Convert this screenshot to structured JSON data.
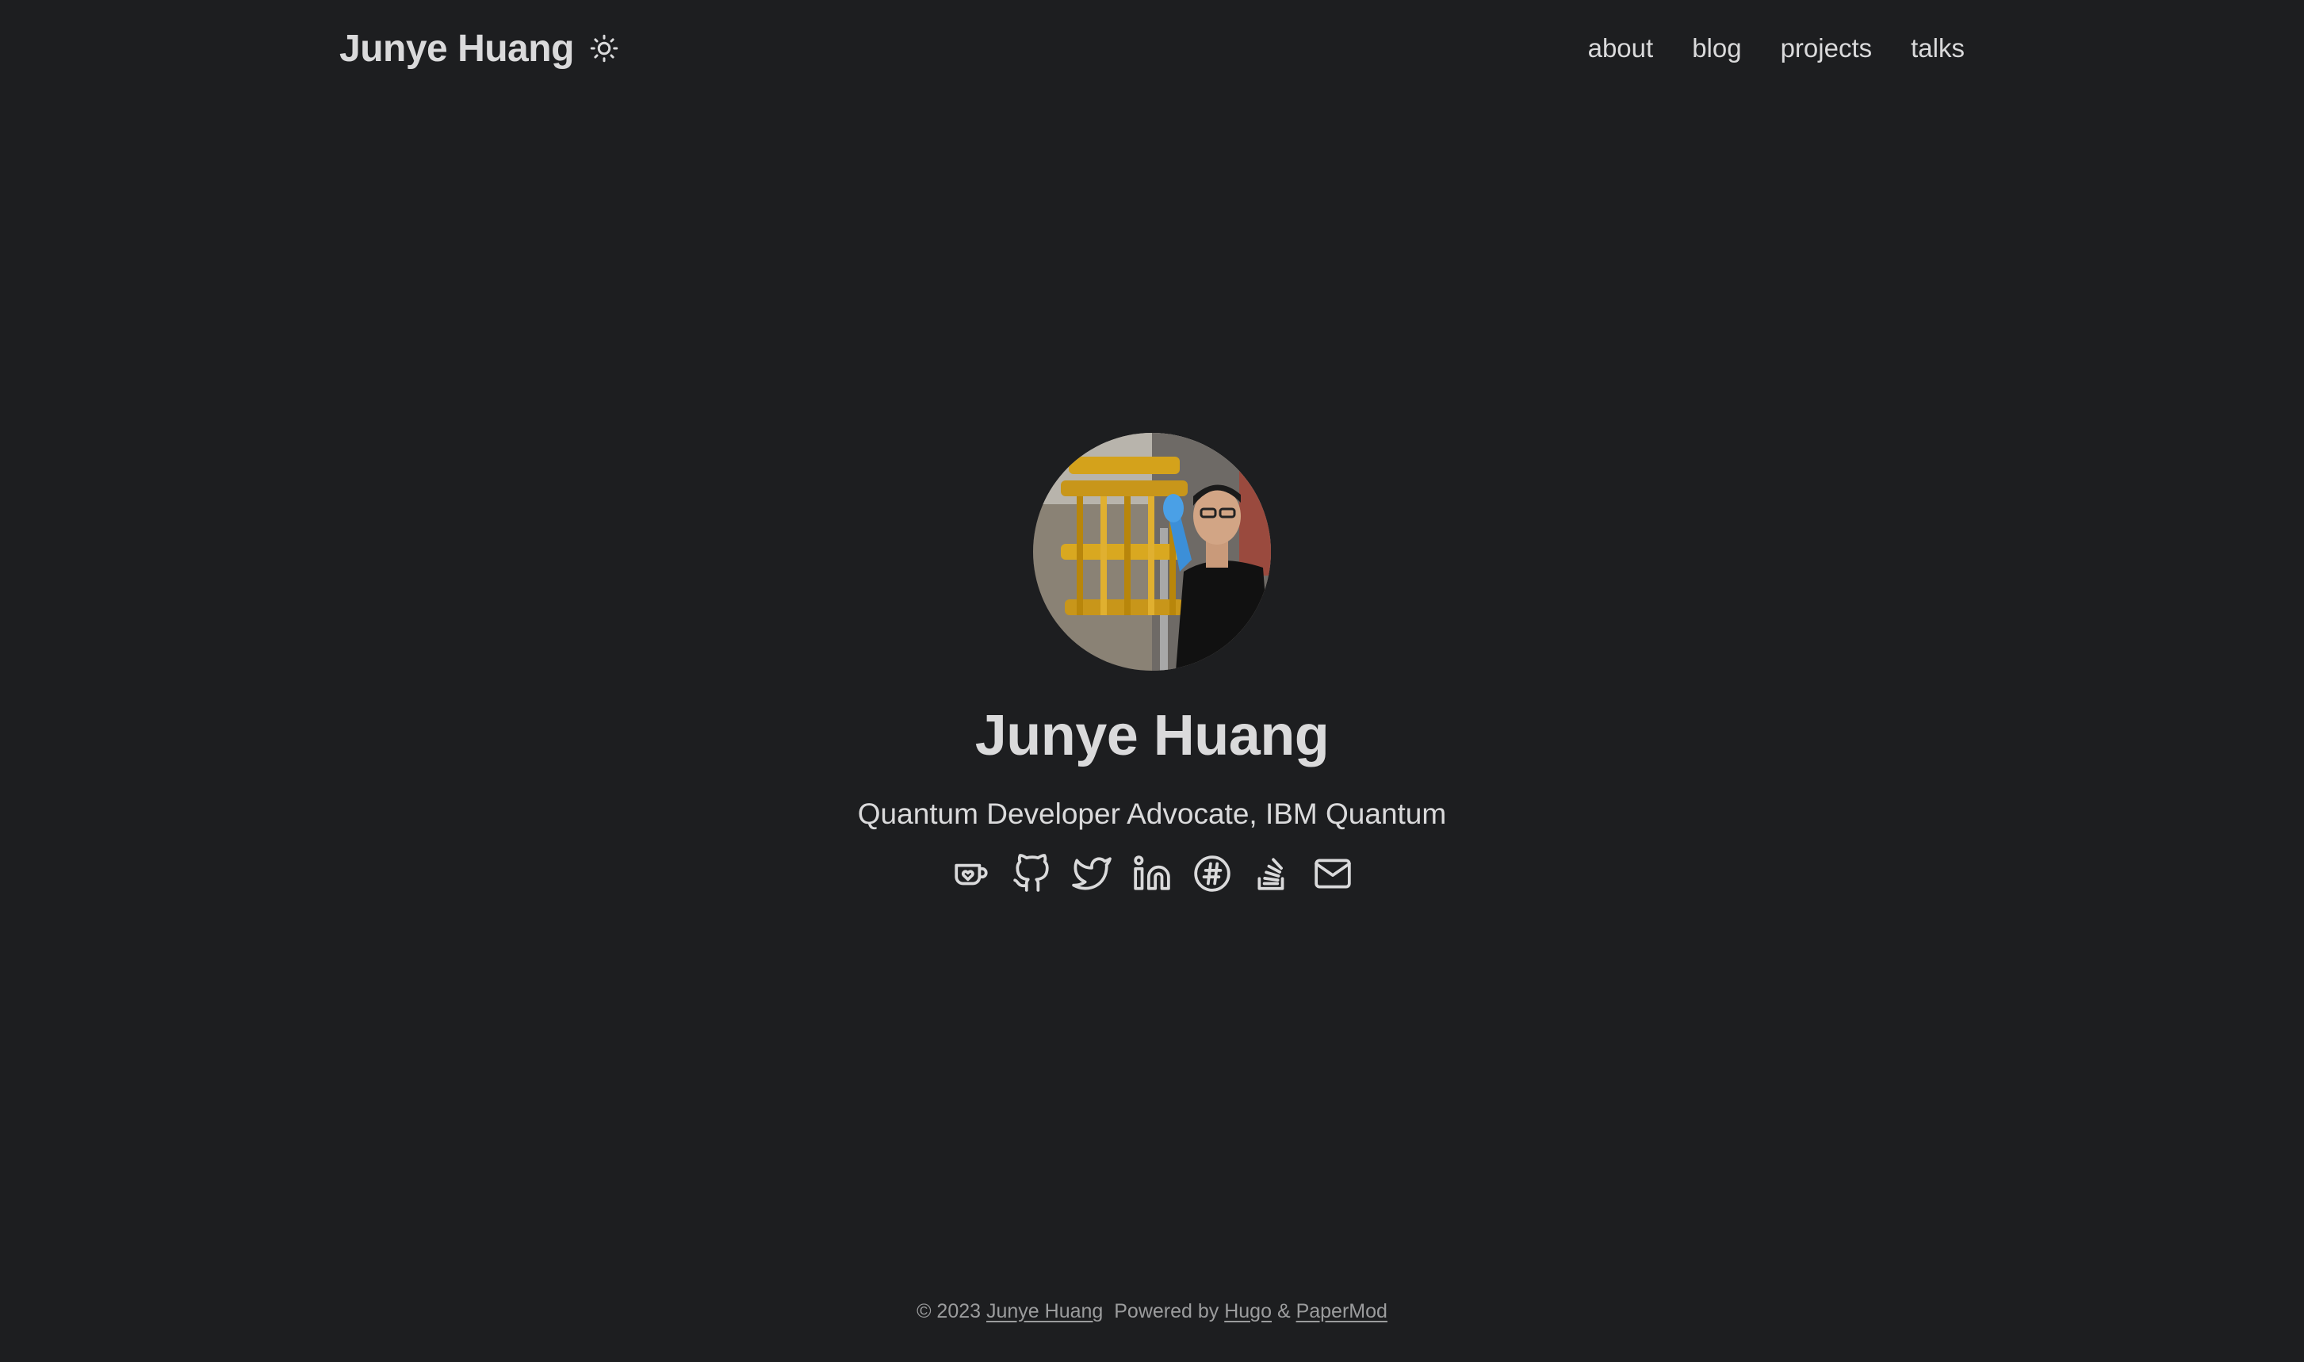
{
  "header": {
    "logo_text": "Junye Huang",
    "theme_toggle_icon": "sun-icon",
    "nav": [
      {
        "label": "about"
      },
      {
        "label": "blog"
      },
      {
        "label": "projects"
      },
      {
        "label": "talks"
      }
    ]
  },
  "profile": {
    "name": "Junye Huang",
    "subtitle": "Quantum Developer Advocate, IBM Quantum",
    "social_icons": [
      "kofi-icon",
      "github-icon",
      "twitter-icon",
      "linkedin-icon",
      "hashnode-icon",
      "stackoverflow-icon",
      "email-icon"
    ]
  },
  "footer": {
    "copyright": "© 2023",
    "author": "Junye Huang",
    "powered_by": "Powered by",
    "hugo": "Hugo",
    "amp": "&",
    "theme": "PaperMod"
  },
  "colors": {
    "background": "#1d1e20",
    "primary_text": "#dadadb",
    "secondary_text": "#9b9c9d"
  }
}
